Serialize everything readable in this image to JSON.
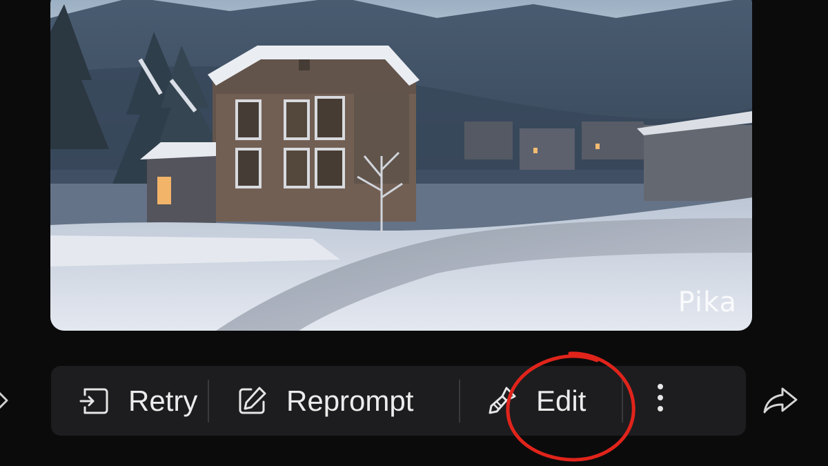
{
  "preview": {
    "watermark": "Pika"
  },
  "action_bar": {
    "retry_label": "Retry",
    "reprompt_label": "Reprompt",
    "edit_label": "Edit"
  },
  "icons": {
    "retry": "retry-icon",
    "reprompt": "edit-pencil-icon",
    "edit": "paintbrush-icon",
    "more": "more-vertical-icon",
    "share": "share-arrow-icon",
    "nav_left": "chevron-right-icon"
  },
  "colors": {
    "background": "#0b0b0c",
    "bar": "#1d1d1f",
    "text": "#ececec",
    "annotation": "#e0241b"
  }
}
